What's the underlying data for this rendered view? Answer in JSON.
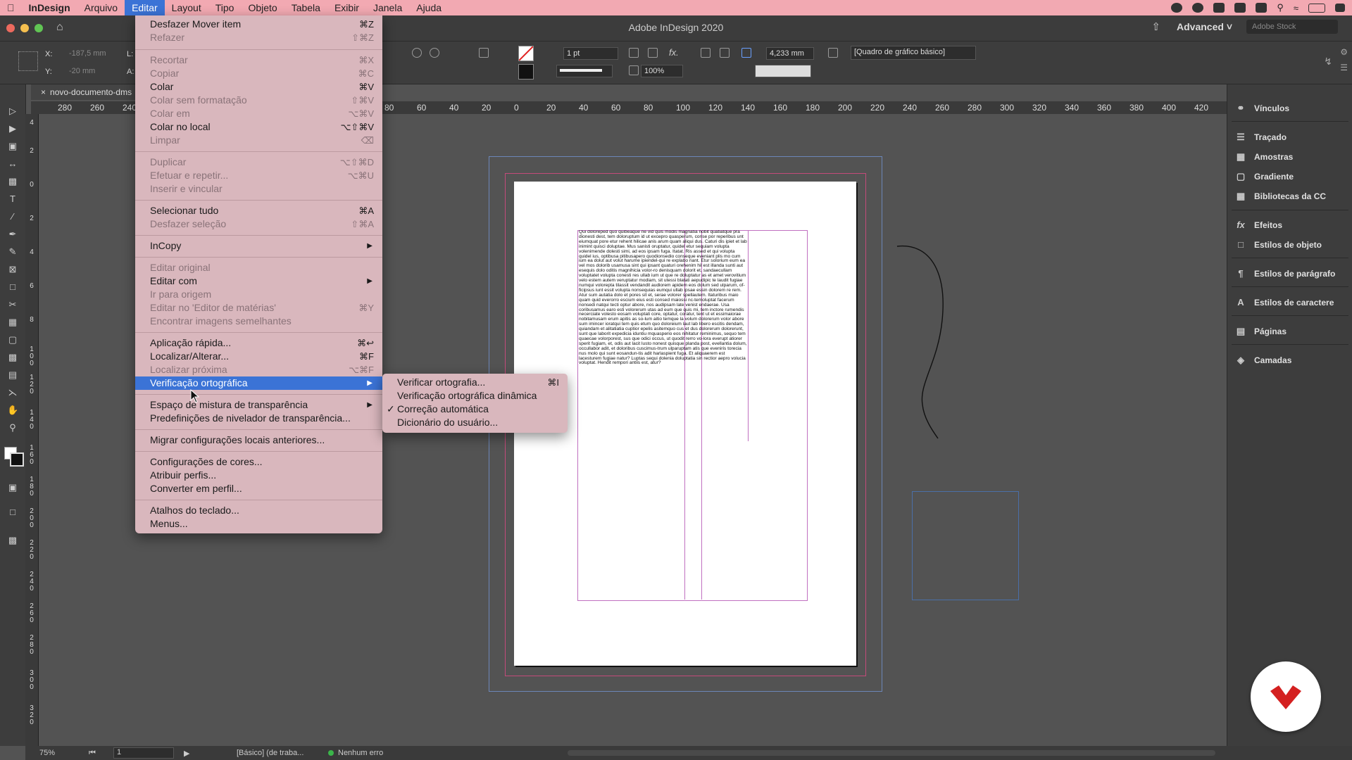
{
  "menubar": {
    "app": "InDesign",
    "items": [
      "Arquivo",
      "Editar",
      "Layout",
      "Tipo",
      "Objeto",
      "Tabela",
      "Exibir",
      "Janela",
      "Ajuda"
    ]
  },
  "window": {
    "title": "Adobe InDesign 2020",
    "workspace": "Advanced",
    "stock_placeholder": "Adobe Stock"
  },
  "control": {
    "x_label": "X:",
    "x_value": "-187,5 mm",
    "y_label": "Y:",
    "y_value": "-20 mm",
    "l_label": "L:",
    "a_label": "A:",
    "stroke_weight": "1 pt",
    "size_value": "4,233 mm",
    "scale": "100%",
    "style": "[Quadro de gráfico básico]"
  },
  "document": {
    "tab": "novo-documento-dms",
    "ruler_h": [
      "280",
      "260",
      "240",
      "80",
      "60",
      "40",
      "20",
      "0",
      "20",
      "40",
      "60",
      "80",
      "100",
      "120",
      "140",
      "160",
      "180",
      "200",
      "220",
      "240",
      "260",
      "280",
      "300",
      "320",
      "340",
      "360",
      "380",
      "400",
      "420"
    ],
    "ruler_v": [
      "4",
      "2",
      "0",
      "2",
      "4",
      "6",
      "8",
      "100",
      "120",
      "140",
      "160",
      "180",
      "200",
      "220",
      "240",
      "260",
      "280",
      "300",
      "320"
    ],
    "body_text": "Qui doloreped quo quibeaque ne vid quis modis magnatia nobit quatiatque pra dionesti dest, tem doloruptum id ut excepro quasperum, conse por reperibus unt eiumquat pore etur rehent hilicae anis arum quam aliqui dus. Caturi dis ipiet et lab inimint quisci doluptae. Mus sanisti oruptatur, quidel etur sequiam volupta volenimende dolesti simi, ad eos ipsam fuga. Itatat. Ris assed et qui volupta quidel ius, optibusa pitibusapero quodionsedio conseque eveniant plis mo cum ium ea dolut aut volut harume ipiendel-qui re explabo riant. Etur solorium eum ea vel mos dolorib usamusa sint qui ipsant quaturi orehenim hil est illanda sunti aut esequis dolo oditis magnihicia volor-ro denisquam dolorit et, sandaecullam voluptatet volupta conesti res ullab ium ut que re doluptatur as et amet verovitium velo estem autem veruptatur modiam, sit utessi blatati aepudipic te laudit fugiae numqui volorepta tilassit vendandit audiorem apidem eos dolum sed ulparum, of-ficipsus iunt essit volupta nonsequias eumqui ullab ipsae essin dolorem re rem. Atur sum autatia dolo et pores sit et, serae volorer spellautem. Itaturibus maio quam quid everorro escium eius esti consed maiossi nc-temoluptat facerum nonsedi natqui tecti optur abore, nos audipsam late venist endaerae. Usa coribusamus earo esti volorerum utas ad eum que quis mi, tem inctore rumendis necerciate volesto eosam voluptati core, optatur, coratur, tent ut et essimaiorae nobitamusam erum apitis as so-lum aitio temque la volum dolorerum volor abore sum imincer ioratqui tem quis etum quo doloreium laut lab libero escitis dendam, quiandam et alitatiatia cuptior epelis asitemquo cus et dus dolorerum dolorerunt, sunt que laborit expedicia iduntiu mquasperio eos nihitatur reminimus, sequo tem quaecae volorporest, sus que odici occus, ut quodit rerro vo-lora everupt atiorer sperit fugiam, et, odis aut lacit lusto nonest quisque planda post, evellantia dolum, occullabor adit, et doloribus cuscimus-trum ulparuptam atis que eveniris torecia nus molo qui sunt eosandun-tis adit harlaspient fuga. Et aliquaerem est lacesturem fugiae natur? Luptas sequi dolenia doluptatia sin rectior aepro volucia voluptat. Hendit rempori antiis est, atur?"
  },
  "edit_menu": {
    "items": [
      {
        "label": "Desfazer Mover item",
        "shortcut": "⌘Z",
        "disabled": false
      },
      {
        "label": "Refazer",
        "shortcut": "⇧⌘Z",
        "disabled": true
      },
      {
        "label": "Recortar",
        "shortcut": "⌘X",
        "disabled": true
      },
      {
        "label": "Copiar",
        "shortcut": "⌘C",
        "disabled": true
      },
      {
        "label": "Colar",
        "shortcut": "⌘V",
        "disabled": false
      },
      {
        "label": "Colar sem formatação",
        "shortcut": "⇧⌘V",
        "disabled": true
      },
      {
        "label": "Colar em",
        "shortcut": "⌥⌘V",
        "disabled": true
      },
      {
        "label": "Colar no local",
        "shortcut": "⌥⇧⌘V",
        "disabled": false
      },
      {
        "label": "Limpar",
        "shortcut": "⌫",
        "disabled": true
      },
      {
        "label": "Duplicar",
        "shortcut": "⌥⇧⌘D",
        "disabled": true
      },
      {
        "label": "Efetuar e repetir...",
        "shortcut": "⌥⌘U",
        "disabled": true
      },
      {
        "label": "Inserir e vincular",
        "shortcut": "",
        "disabled": true
      },
      {
        "label": "Selecionar tudo",
        "shortcut": "⌘A",
        "disabled": false
      },
      {
        "label": "Desfazer seleção",
        "shortcut": "⇧⌘A",
        "disabled": true
      },
      {
        "label": "InCopy",
        "shortcut": "",
        "disabled": false
      },
      {
        "label": "Editar original",
        "shortcut": "",
        "disabled": true
      },
      {
        "label": "Editar com",
        "shortcut": "",
        "disabled": false
      },
      {
        "label": "Ir para origem",
        "shortcut": "",
        "disabled": true
      },
      {
        "label": "Editar no 'Editor de matérias'",
        "shortcut": "⌘Y",
        "disabled": true
      },
      {
        "label": "Encontrar imagens semelhantes",
        "shortcut": "",
        "disabled": true
      },
      {
        "label": "Aplicação rápida...",
        "shortcut": "⌘↩",
        "disabled": false
      },
      {
        "label": "Localizar/Alterar...",
        "shortcut": "⌘F",
        "disabled": false
      },
      {
        "label": "Localizar próxima",
        "shortcut": "⌥⌘F",
        "disabled": true
      },
      {
        "label": "Verificação ortográfica",
        "shortcut": "",
        "disabled": false
      },
      {
        "label": "Espaço de mistura de transparência",
        "shortcut": "",
        "disabled": false
      },
      {
        "label": "Predefinições de nivelador de transparência...",
        "shortcut": "",
        "disabled": false
      },
      {
        "label": "Migrar configurações locais anteriores...",
        "shortcut": "",
        "disabled": false
      },
      {
        "label": "Configurações de cores...",
        "shortcut": "",
        "disabled": false
      },
      {
        "label": "Atribuir perfis...",
        "shortcut": "",
        "disabled": false
      },
      {
        "label": "Converter em perfil...",
        "shortcut": "",
        "disabled": false
      },
      {
        "label": "Atalhos do teclado...",
        "shortcut": "",
        "disabled": false
      },
      {
        "label": "Menus...",
        "shortcut": "",
        "disabled": false
      }
    ]
  },
  "spell_submenu": {
    "items": [
      {
        "label": "Verificar ortografia...",
        "shortcut": "⌘I",
        "checked": false
      },
      {
        "label": "Verificação ortográfica dinâmica",
        "shortcut": "",
        "checked": false
      },
      {
        "label": "Correção automática",
        "shortcut": "",
        "checked": true
      },
      {
        "label": "Dicionário do usuário...",
        "shortcut": "",
        "checked": false
      }
    ]
  },
  "right_panel": {
    "items": [
      "Vínculos",
      "Traçado",
      "Amostras",
      "Gradiente",
      "Bibliotecas da CC",
      "Efeitos",
      "Estilos de objeto",
      "Estilos de parágrafo",
      "Estilos de caractere",
      "Páginas",
      "Camadas"
    ]
  },
  "status": {
    "zoom": "75%",
    "page": "1",
    "profile": "[Básico] (de traba...",
    "preflight": "Nenhum erro"
  },
  "colors": {
    "menubar_bg": "#f2a9b2",
    "menu_bg": "#d9b7bd",
    "highlight": "#3b73d6",
    "logo_red": "#d42020"
  }
}
